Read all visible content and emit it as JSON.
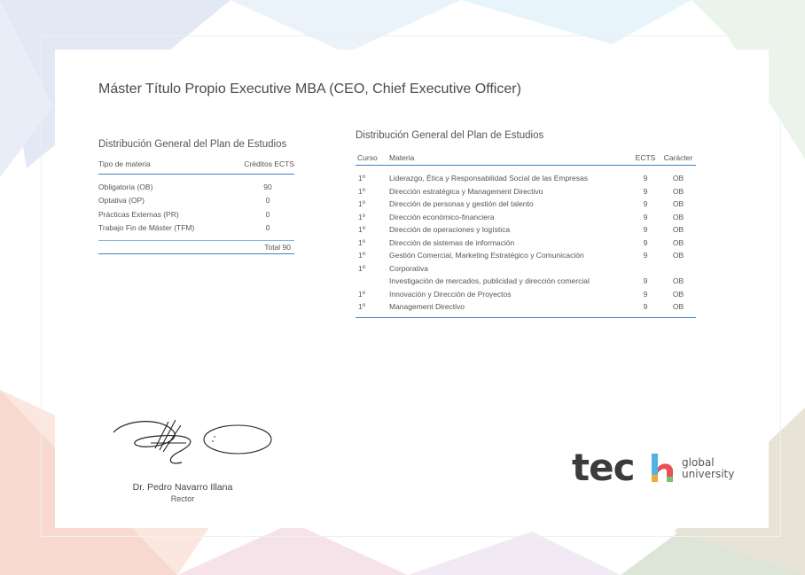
{
  "document": {
    "title": "Máster Título Propio Executive MBA (CEO, Chief Executive Officer)"
  },
  "general_distribution": {
    "heading": "Distribución General del Plan de Estudios",
    "col_type": "Tipo de materia",
    "col_credits": "Créditos ECTS",
    "rows": [
      {
        "type": "Obligatoria (OB)",
        "credits": "90"
      },
      {
        "type": "Optativa (OP)",
        "credits": "0"
      },
      {
        "type": "Prácticas Externas (PR)",
        "credits": "0"
      },
      {
        "type": "Trabajo Fin de Máster (TFM)",
        "credits": "0"
      }
    ],
    "total": "Total 90"
  },
  "subjects_distribution": {
    "heading": "Distribución General del Plan de Estudios",
    "col_course": "Curso",
    "col_subject": "Materia",
    "col_ects": "ECTS",
    "col_character": "Carácter",
    "rows": [
      {
        "course": "1º",
        "subject": "Liderazgo, Ética y Responsabilidad Social de las Empresas",
        "ects": "9",
        "character": "OB"
      },
      {
        "course": "1º",
        "subject": "Dirección estratégica y Management Directivo",
        "ects": "9",
        "character": "OB"
      },
      {
        "course": "1º",
        "subject": "Dirección de personas y gestión del talento",
        "ects": "9",
        "character": "OB"
      },
      {
        "course": "1º",
        "subject": "Dirección económico-financiera",
        "ects": "9",
        "character": "OB"
      },
      {
        "course": "1º",
        "subject": "Dirección de operaciones y logística",
        "ects": "9",
        "character": "OB"
      },
      {
        "course": "1º",
        "subject": "Dirección de sistemas de información",
        "ects": "9",
        "character": "OB"
      },
      {
        "course": "1º",
        "subject": "Gestión Comercial, Marketing Estratégico y Comunicación",
        "ects": "9",
        "character": "OB"
      },
      {
        "course": "1º",
        "subject": "Corporativa",
        "ects": "",
        "character": ""
      },
      {
        "course": "",
        "subject": "Investigación de mercados, publicidad y dirección comercial",
        "ects": "9",
        "character": "OB"
      },
      {
        "course": "1º",
        "subject": "Innovación y Dirección de Proyectos",
        "ects": "9",
        "character": "OB"
      },
      {
        "course": "1º",
        "subject": "Management Directivo",
        "ects": "9",
        "character": "OB"
      }
    ]
  },
  "signatory": {
    "name": "Dr. Pedro Navarro Illana",
    "role": "Rector"
  },
  "logo": {
    "word": "tec",
    "line1": "global",
    "line2": "university",
    "colors": [
      "#f2a93b",
      "#e8505b",
      "#4fb3e8",
      "#7ac36a"
    ]
  }
}
